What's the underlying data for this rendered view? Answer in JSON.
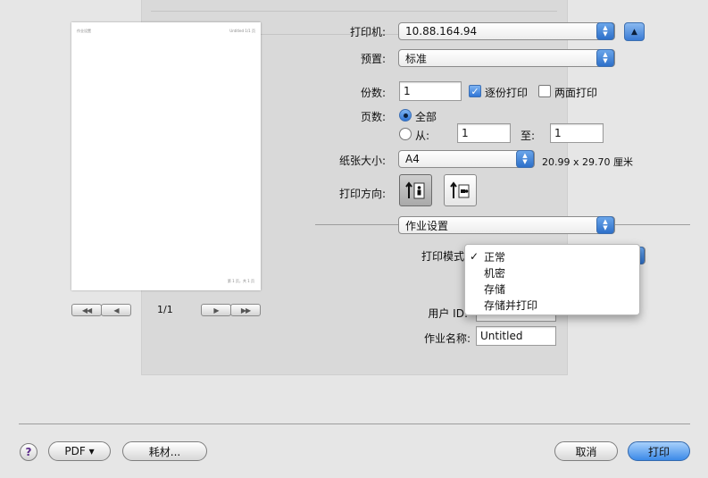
{
  "preview": {
    "header_left": "作业设置",
    "header_right": "Untitled 1/1 页",
    "footer": "第 1 页，共 1 页",
    "page_indicator": "1/1",
    "first_label": "◀◀",
    "prev_label": "◀",
    "next_label": "▶",
    "last_label": "▶▶"
  },
  "printer": {
    "label": "打印机:",
    "value": "10.88.164.94",
    "expand_icon": "triangle-up-icon"
  },
  "presets": {
    "label": "预置:",
    "value": "标准"
  },
  "copies": {
    "label": "份数:",
    "value": "1",
    "collated_label": "逐份打印",
    "collated": true,
    "duplex_label": "两面打印",
    "duplex": false
  },
  "pages": {
    "label": "页数:",
    "all_label": "全部",
    "from_label": "从:",
    "from_value": "1",
    "to_label": "至:",
    "to_value": "1",
    "selected": "all"
  },
  "paper": {
    "label": "纸张大小:",
    "value": "A4",
    "dimensions": "20.99 x 29.70 厘米"
  },
  "orientation": {
    "label": "打印方向:",
    "selected": "portrait"
  },
  "section": {
    "value": "作业设置"
  },
  "print_mode": {
    "label": "打印模式",
    "options": [
      "正常",
      "机密",
      "存储",
      "存储并打印"
    ],
    "selected_index": 0
  },
  "user_id": {
    "label": "用户 ID:"
  },
  "job_name": {
    "label": "作业名称:",
    "value": "Untitled"
  },
  "bottom": {
    "help": "?",
    "pdf_label": "PDF ▾",
    "supplies_label": "耗材...",
    "cancel_label": "取消",
    "print_label": "打印"
  }
}
